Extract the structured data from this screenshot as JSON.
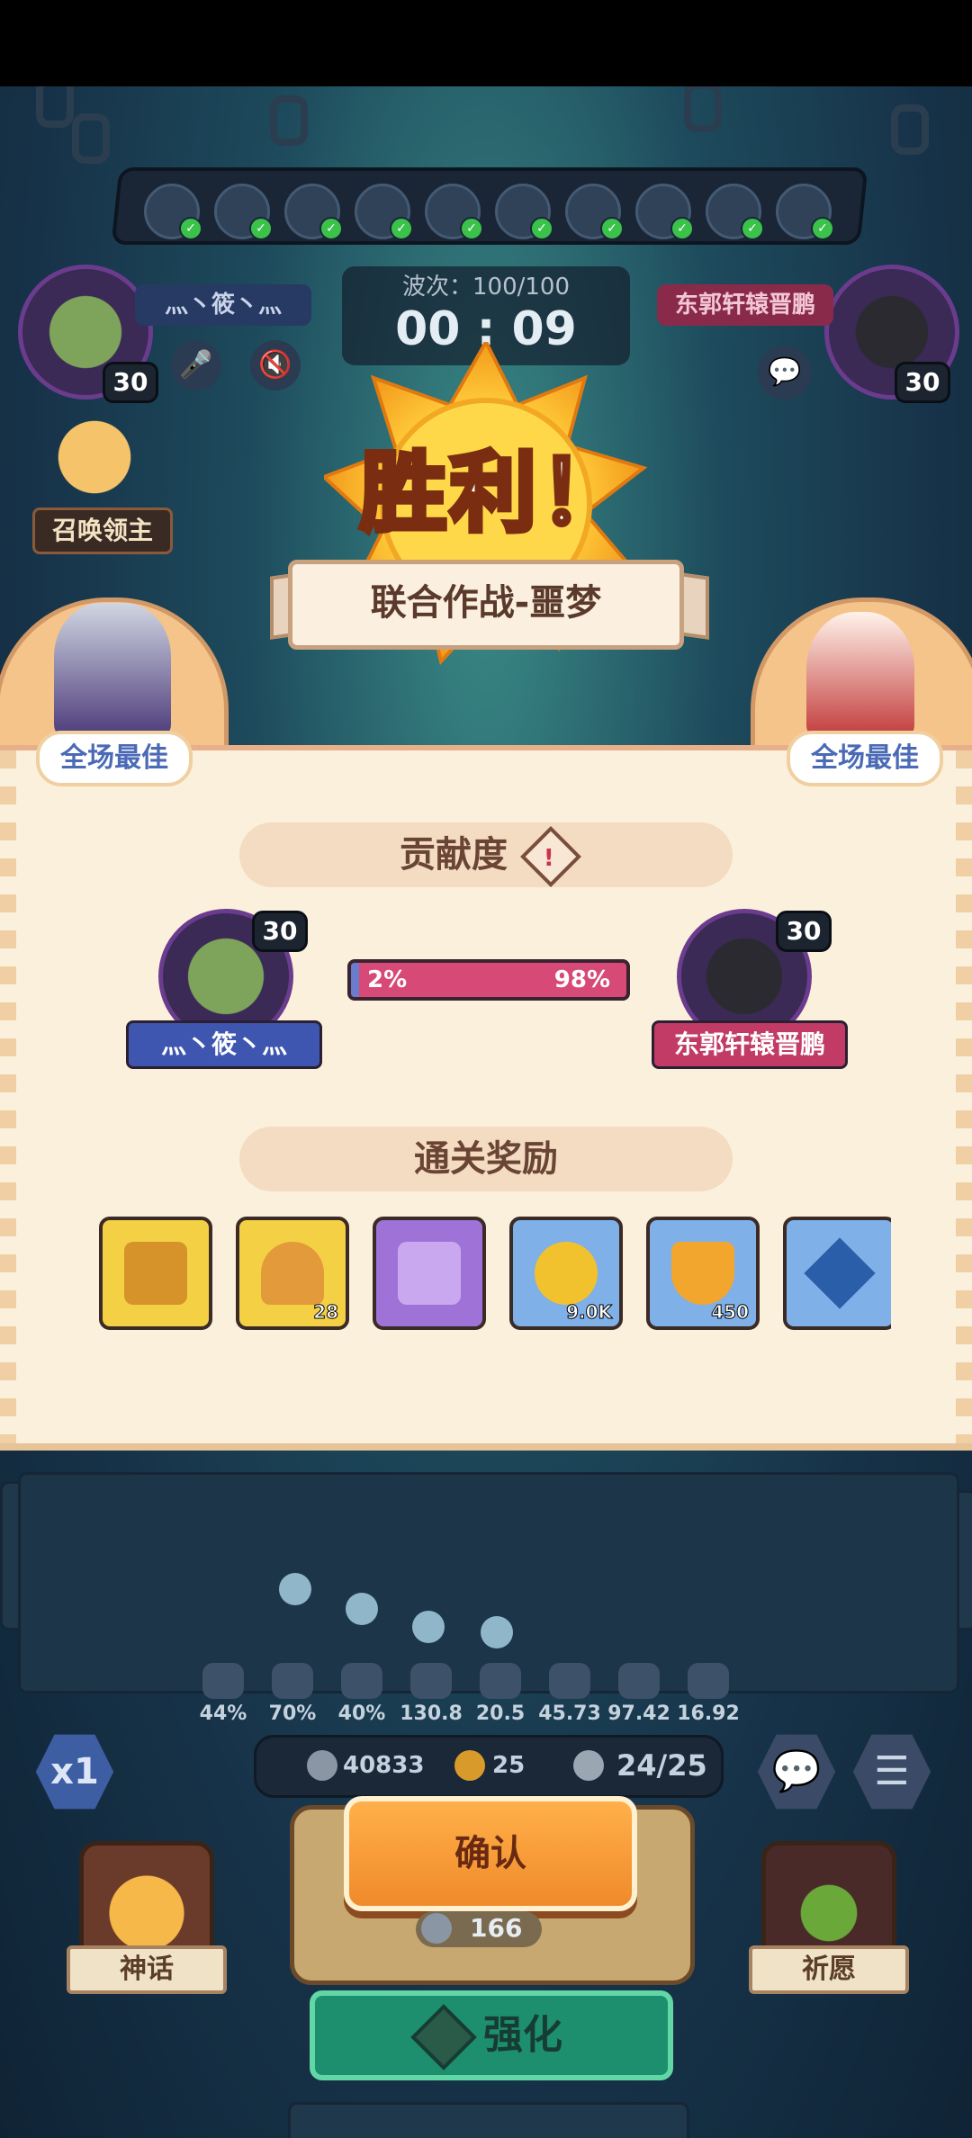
{
  "game": {
    "wave": "波次：100/100",
    "timer": "00 : 09",
    "victory_title": "胜利！",
    "mode_banner": "联合作战-噩梦",
    "summon_lord": "召唤领主",
    "best_left": "全场最佳",
    "best_right": "全场最佳"
  },
  "players": {
    "left": {
      "name": "灬丶筱丶灬",
      "level": "30"
    },
    "right": {
      "name": "东郭轩辕晋鹏",
      "level": "30"
    }
  },
  "contribution": {
    "title": "贡献度",
    "left_pct_label": "2%",
    "right_pct_label": "98%",
    "left_fraction": 0.02
  },
  "rewards": {
    "title": "通关奖励",
    "items": [
      {
        "name": "gold-chest",
        "qty": ""
      },
      {
        "name": "key",
        "qty": "28"
      },
      {
        "name": "purple-chest",
        "qty": ""
      },
      {
        "name": "gold-coin",
        "qty": "9.0K"
      },
      {
        "name": "trophy",
        "qty": "450"
      },
      {
        "name": "blue-gem",
        "qty": ""
      }
    ]
  },
  "stats": [
    "44%",
    "70%",
    "40%",
    "130.8",
    "20.5",
    "45.73",
    "97.42",
    "16.92"
  ],
  "resources": {
    "coins": "40833",
    "clover": "25",
    "capacity": "24/25"
  },
  "speed": "x1",
  "confirm_label": "确认",
  "confirm_cost": "166",
  "strengthen_label": "强化",
  "left_corner": "神话",
  "right_corner": "祈愿",
  "colors": {
    "accent": "#f08a2a",
    "panel": "#fbf0dc",
    "blue_tag": "#3f56b0",
    "pink_tag": "#c23a66"
  }
}
